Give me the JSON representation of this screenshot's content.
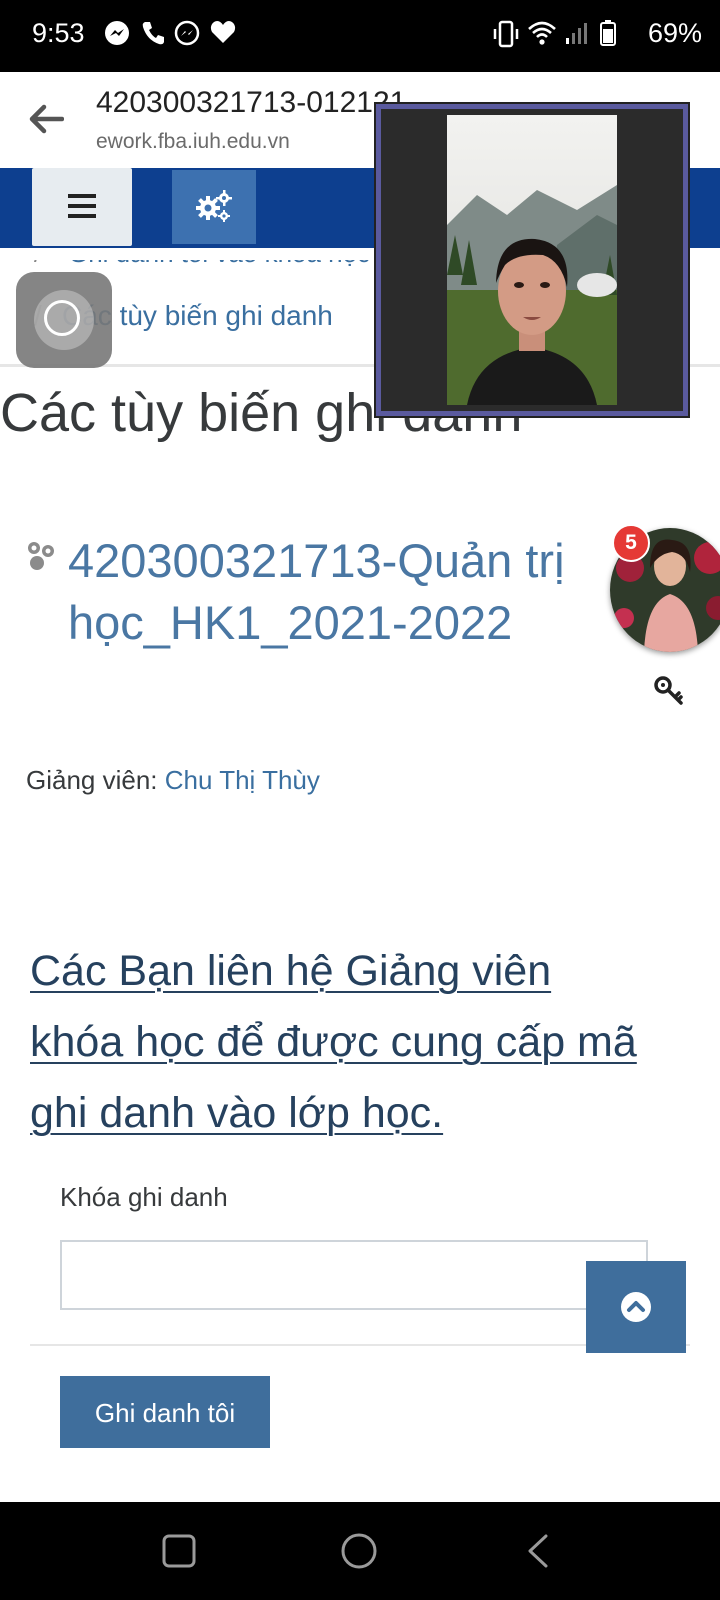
{
  "status_bar": {
    "time": "9:53",
    "battery": "69%",
    "icons": [
      "messenger-icon",
      "phone-icon",
      "messenger-icon",
      "heart-icon",
      "vibrate-icon",
      "wifi-icon",
      "signal-icon",
      "battery-icon"
    ]
  },
  "browser": {
    "title": "420300321713-012121",
    "url": "ework.fba.iuh.edu.vn"
  },
  "breadcrumb": {
    "items": [
      "Ghi danh tôi vào khóa học",
      "Các tùy biến ghi danh"
    ]
  },
  "page": {
    "title": "Các tùy biến ghi danh"
  },
  "course": {
    "title": "420300321713-Quản trị học_HK1_2021-2022",
    "teacher_label": "Giảng viên:",
    "teacher_name": "Chu Thị Thùy"
  },
  "notice": "Các Bạn liên hệ Giảng viên khóa học để được cung cấp mã ghi danh vào lớp học.",
  "form": {
    "key_label": "Khóa ghi danh",
    "key_value": "",
    "submit_label": "Ghi danh tôi"
  },
  "chat_head": {
    "badge": "5"
  },
  "colors": {
    "navbar": "#0d3f8f",
    "link": "#3a6fa0",
    "button": "#3f6e9c"
  }
}
